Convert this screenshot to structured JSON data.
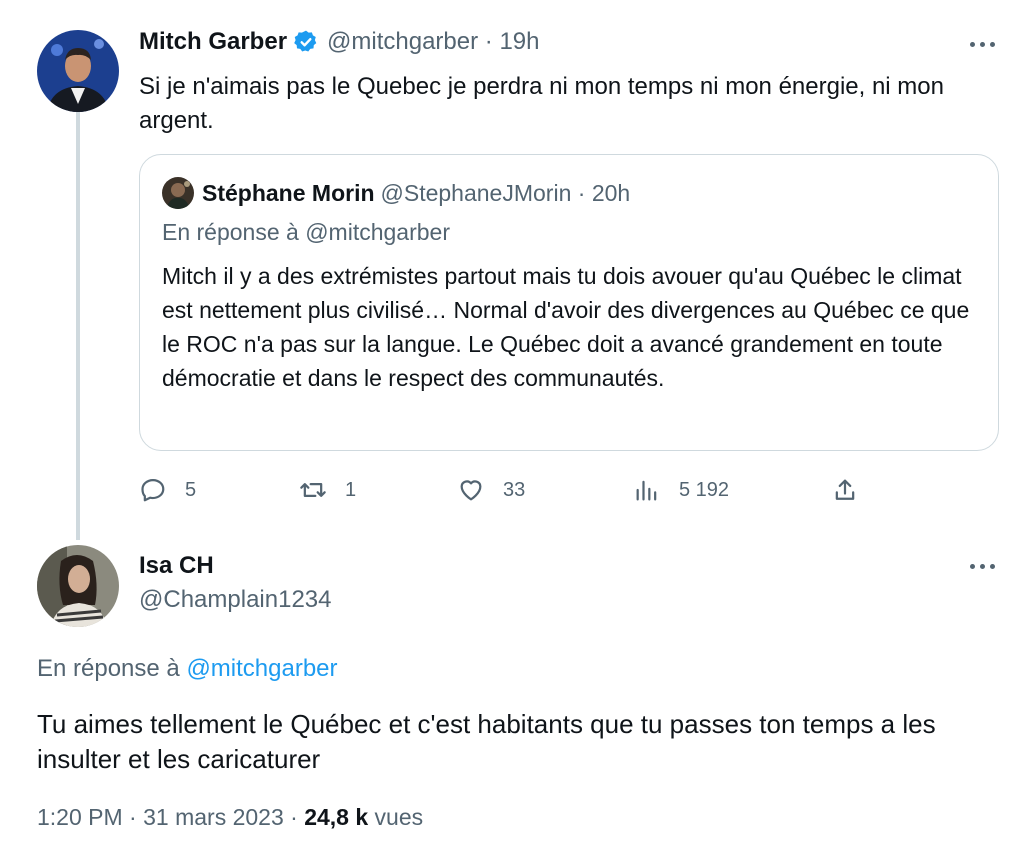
{
  "tweet1": {
    "author_name": "Mitch Garber",
    "handle": "@mitchgarber",
    "separator": " · ",
    "time": "19h",
    "text": "Si je n'aimais pas le Quebec je perdra ni mon temps ni mon énergie, ni mon argent.",
    "quote": {
      "author_name": "Stéphane Morin",
      "handle": "@StephaneJMorin",
      "separator": " · ",
      "time": "20h",
      "reply_to": "En réponse à @mitchgarber",
      "text": "Mitch il y a des extrémistes partout mais tu dois avouer qu'au Québec le climat est nettement plus civilisé… Normal d'avoir des divergences au Québec ce que le ROC n'a pas sur la langue. Le Québec doit a avancé grandement en toute démocratie et dans le respect des communautés."
    },
    "actions": {
      "replies": "5",
      "retweets": "1",
      "likes": "33",
      "views": "5 192"
    }
  },
  "tweet2": {
    "author_name": "Isa CH",
    "handle": "@Champlain1234",
    "reply_prefix": "En réponse à ",
    "reply_handle": "@mitchgarber",
    "text": "Tu aimes tellement le Québec et c'est habitants que tu passes ton temps a les insulter et les caricaturer",
    "time": "1:20 PM",
    "separator": " · ",
    "date": "31 mars 2023",
    "views_count": "24,8 k",
    "views_label": " vues"
  },
  "colors": {
    "text": "#0f1419",
    "muted": "#536471",
    "link": "#1d9bf0",
    "verified": "#1d9bf0",
    "border": "#cfd9de"
  },
  "icons": [
    "verified-badge-icon",
    "more-icon",
    "reply-icon",
    "retweet-icon",
    "like-icon",
    "views-icon",
    "share-icon"
  ]
}
